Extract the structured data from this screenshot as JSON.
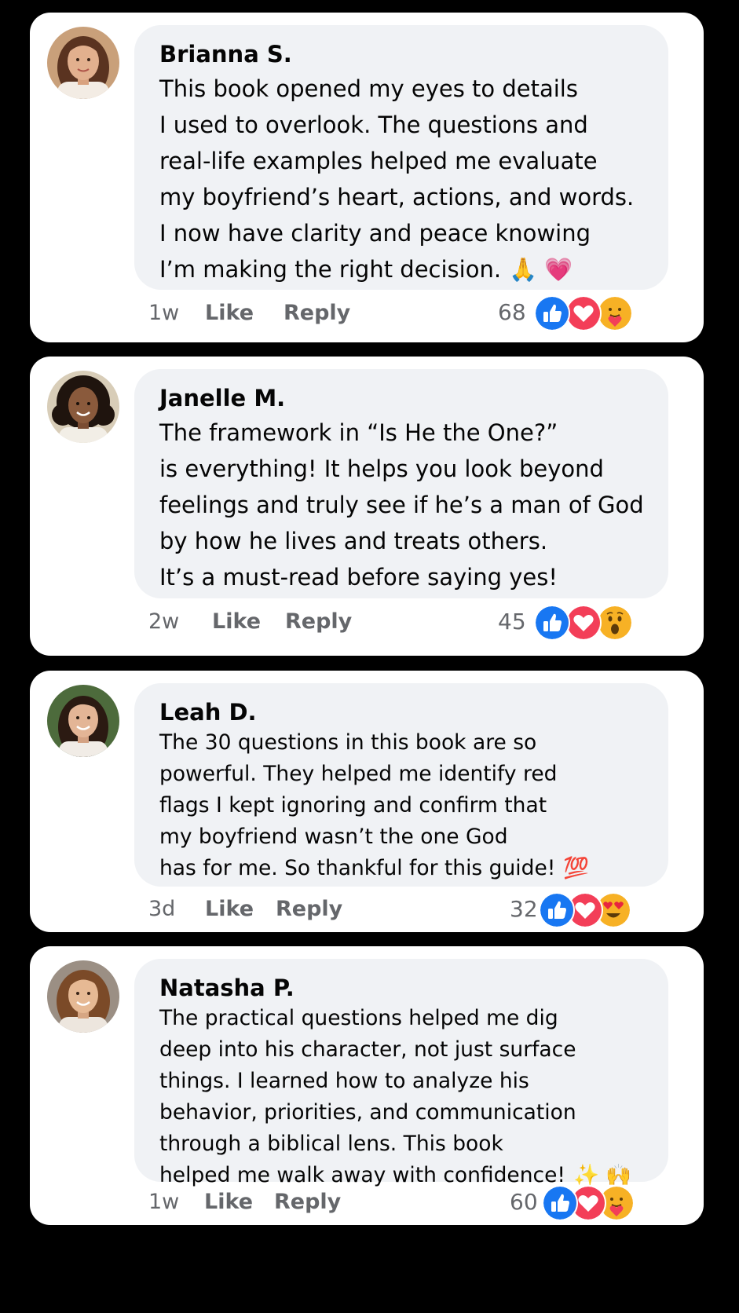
{
  "comments": [
    {
      "author": "Brianna S.",
      "lines": [
        "This book opened my eyes to details",
        "I used to overlook. The questions and",
        "real-life examples helped me evaluate",
        "my boyfriend’s heart, actions, and words.",
        "I now have clarity and peace knowing",
        "I’m making the right decision."
      ],
      "trailing_emoji": "🙏 💗",
      "time": "1w",
      "like_label": "Like",
      "reply_label": "Reply",
      "reaction_count": "68",
      "reactions": [
        "like-icon",
        "love-icon",
        "care-icon"
      ],
      "avatar_colors": {
        "bg": "#c9a07a",
        "hair": "#5a3320",
        "skin": "#e2b08e",
        "top": "#f3ece4"
      }
    },
    {
      "author": "Janelle M.",
      "lines": [
        "The framework in “Is He the One?”",
        "is everything! It helps you look beyond",
        "feelings and truly see if he’s a man of God",
        "by how he lives and treats others.",
        "It’s a must-read before saying yes!"
      ],
      "trailing_emoji": "",
      "time": "2w",
      "like_label": "Like",
      "reply_label": "Reply",
      "reaction_count": "45",
      "reactions": [
        "like-icon",
        "love-icon",
        "wow-icon"
      ],
      "avatar_colors": {
        "bg": "#d8cdb8",
        "hair": "#1f140e",
        "skin": "#8a5a3c",
        "top": "#f2eee6"
      }
    },
    {
      "author": "Leah D.",
      "lines": [
        "The 30 questions in this book are so",
        "powerful. They helped me identify red",
        "flags I kept ignoring and confirm that",
        "my boyfriend wasn’t the one God",
        "has for me. So thankful for this guide!"
      ],
      "trailing_emoji": "💯",
      "time": "3d",
      "like_label": "Like",
      "reply_label": "Reply",
      "reaction_count": "32",
      "reactions": [
        "like-icon",
        "love-icon",
        "heart-eyes-icon"
      ],
      "avatar_colors": {
        "bg": "#4d6b3c",
        "hair": "#2b1a12",
        "skin": "#e3b596",
        "top": "#f1ece6"
      }
    },
    {
      "author": "Natasha P.",
      "lines": [
        "The practical questions helped me dig",
        "deep into his character, not just surface",
        "things. I learned how to analyze his",
        "behavior, priorities, and communication",
        "through a biblical lens. This book",
        "helped me walk away with confidence!"
      ],
      "trailing_emoji": "✨ 🙌",
      "time": "1w",
      "like_label": "Like",
      "reply_label": "Reply",
      "reaction_count": "60",
      "reactions": [
        "like-icon",
        "love-icon",
        "care-icon"
      ],
      "avatar_colors": {
        "bg": "#9b8f84",
        "hair": "#7b4a28",
        "skin": "#e6b994",
        "top": "#ede6de"
      }
    }
  ],
  "colors": {
    "page_bg": "#000000",
    "card_bg": "#ffffff",
    "bubble_bg": "#f0f2f5",
    "meta_text": "#65676b",
    "like_blue": "#1877f2",
    "love_red": "#f33e58",
    "emoji_yellow": "#f7b125"
  }
}
